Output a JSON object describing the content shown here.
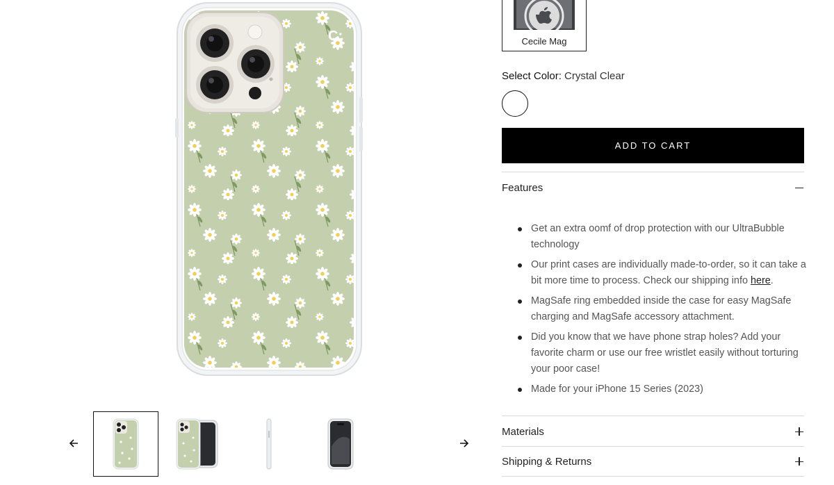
{
  "variant": {
    "label": "Cecile Mag"
  },
  "color": {
    "label": "Select Color:",
    "value": "Crystal Clear"
  },
  "add_to_cart": "ADD TO CART",
  "features": {
    "title": "Features",
    "items": [
      {
        "text": "Get an extra oomf of drop protection with our UltraBubble technology"
      },
      {
        "text": "Our print cases are individually made-to-order, so it can take a bit more time to process. Check our shipping info ",
        "link": "here",
        "after": "."
      },
      {
        "text": "MagSafe ring embedded inside the case for easy MagSafe charging and MagSafe accessory attachment."
      },
      {
        "text": "Did you know that we have phone strap holes? Add your favorite charm or use our free wristlet easily without torturing your poor case!"
      },
      {
        "text": "Made for your iPhone 15 Series (2023)"
      }
    ]
  },
  "materials": {
    "title": "Materials"
  },
  "shipping": {
    "title": "Shipping & Returns"
  },
  "colors": {
    "case_bg": "#c4cfae",
    "button_bg": "#000000",
    "button_text": "#ffffff"
  }
}
